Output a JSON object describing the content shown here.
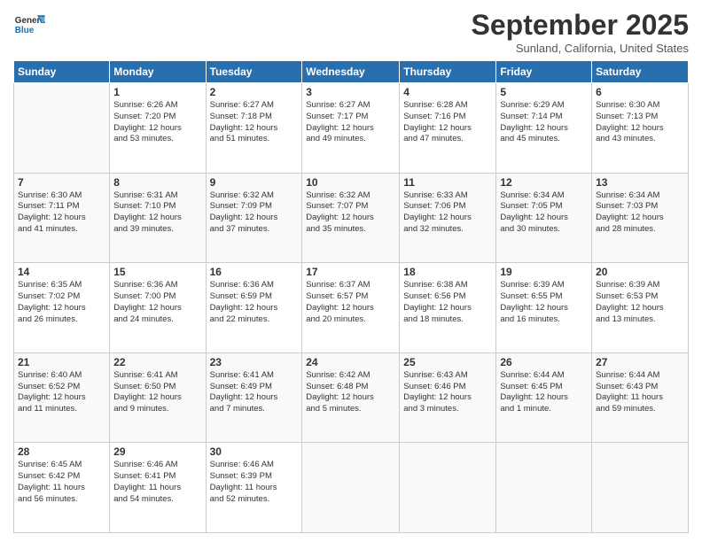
{
  "header": {
    "logo_text_general": "General",
    "logo_text_blue": "Blue",
    "month": "September 2025",
    "location": "Sunland, California, United States"
  },
  "days_of_week": [
    "Sunday",
    "Monday",
    "Tuesday",
    "Wednesday",
    "Thursday",
    "Friday",
    "Saturday"
  ],
  "weeks": [
    [
      {
        "num": "",
        "info": ""
      },
      {
        "num": "1",
        "info": "Sunrise: 6:26 AM\nSunset: 7:20 PM\nDaylight: 12 hours\nand 53 minutes."
      },
      {
        "num": "2",
        "info": "Sunrise: 6:27 AM\nSunset: 7:18 PM\nDaylight: 12 hours\nand 51 minutes."
      },
      {
        "num": "3",
        "info": "Sunrise: 6:27 AM\nSunset: 7:17 PM\nDaylight: 12 hours\nand 49 minutes."
      },
      {
        "num": "4",
        "info": "Sunrise: 6:28 AM\nSunset: 7:16 PM\nDaylight: 12 hours\nand 47 minutes."
      },
      {
        "num": "5",
        "info": "Sunrise: 6:29 AM\nSunset: 7:14 PM\nDaylight: 12 hours\nand 45 minutes."
      },
      {
        "num": "6",
        "info": "Sunrise: 6:30 AM\nSunset: 7:13 PM\nDaylight: 12 hours\nand 43 minutes."
      }
    ],
    [
      {
        "num": "7",
        "info": "Sunrise: 6:30 AM\nSunset: 7:11 PM\nDaylight: 12 hours\nand 41 minutes."
      },
      {
        "num": "8",
        "info": "Sunrise: 6:31 AM\nSunset: 7:10 PM\nDaylight: 12 hours\nand 39 minutes."
      },
      {
        "num": "9",
        "info": "Sunrise: 6:32 AM\nSunset: 7:09 PM\nDaylight: 12 hours\nand 37 minutes."
      },
      {
        "num": "10",
        "info": "Sunrise: 6:32 AM\nSunset: 7:07 PM\nDaylight: 12 hours\nand 35 minutes."
      },
      {
        "num": "11",
        "info": "Sunrise: 6:33 AM\nSunset: 7:06 PM\nDaylight: 12 hours\nand 32 minutes."
      },
      {
        "num": "12",
        "info": "Sunrise: 6:34 AM\nSunset: 7:05 PM\nDaylight: 12 hours\nand 30 minutes."
      },
      {
        "num": "13",
        "info": "Sunrise: 6:34 AM\nSunset: 7:03 PM\nDaylight: 12 hours\nand 28 minutes."
      }
    ],
    [
      {
        "num": "14",
        "info": "Sunrise: 6:35 AM\nSunset: 7:02 PM\nDaylight: 12 hours\nand 26 minutes."
      },
      {
        "num": "15",
        "info": "Sunrise: 6:36 AM\nSunset: 7:00 PM\nDaylight: 12 hours\nand 24 minutes."
      },
      {
        "num": "16",
        "info": "Sunrise: 6:36 AM\nSunset: 6:59 PM\nDaylight: 12 hours\nand 22 minutes."
      },
      {
        "num": "17",
        "info": "Sunrise: 6:37 AM\nSunset: 6:57 PM\nDaylight: 12 hours\nand 20 minutes."
      },
      {
        "num": "18",
        "info": "Sunrise: 6:38 AM\nSunset: 6:56 PM\nDaylight: 12 hours\nand 18 minutes."
      },
      {
        "num": "19",
        "info": "Sunrise: 6:39 AM\nSunset: 6:55 PM\nDaylight: 12 hours\nand 16 minutes."
      },
      {
        "num": "20",
        "info": "Sunrise: 6:39 AM\nSunset: 6:53 PM\nDaylight: 12 hours\nand 13 minutes."
      }
    ],
    [
      {
        "num": "21",
        "info": "Sunrise: 6:40 AM\nSunset: 6:52 PM\nDaylight: 12 hours\nand 11 minutes."
      },
      {
        "num": "22",
        "info": "Sunrise: 6:41 AM\nSunset: 6:50 PM\nDaylight: 12 hours\nand 9 minutes."
      },
      {
        "num": "23",
        "info": "Sunrise: 6:41 AM\nSunset: 6:49 PM\nDaylight: 12 hours\nand 7 minutes."
      },
      {
        "num": "24",
        "info": "Sunrise: 6:42 AM\nSunset: 6:48 PM\nDaylight: 12 hours\nand 5 minutes."
      },
      {
        "num": "25",
        "info": "Sunrise: 6:43 AM\nSunset: 6:46 PM\nDaylight: 12 hours\nand 3 minutes."
      },
      {
        "num": "26",
        "info": "Sunrise: 6:44 AM\nSunset: 6:45 PM\nDaylight: 12 hours\nand 1 minute."
      },
      {
        "num": "27",
        "info": "Sunrise: 6:44 AM\nSunset: 6:43 PM\nDaylight: 11 hours\nand 59 minutes."
      }
    ],
    [
      {
        "num": "28",
        "info": "Sunrise: 6:45 AM\nSunset: 6:42 PM\nDaylight: 11 hours\nand 56 minutes."
      },
      {
        "num": "29",
        "info": "Sunrise: 6:46 AM\nSunset: 6:41 PM\nDaylight: 11 hours\nand 54 minutes."
      },
      {
        "num": "30",
        "info": "Sunrise: 6:46 AM\nSunset: 6:39 PM\nDaylight: 11 hours\nand 52 minutes."
      },
      {
        "num": "",
        "info": ""
      },
      {
        "num": "",
        "info": ""
      },
      {
        "num": "",
        "info": ""
      },
      {
        "num": "",
        "info": ""
      }
    ]
  ]
}
